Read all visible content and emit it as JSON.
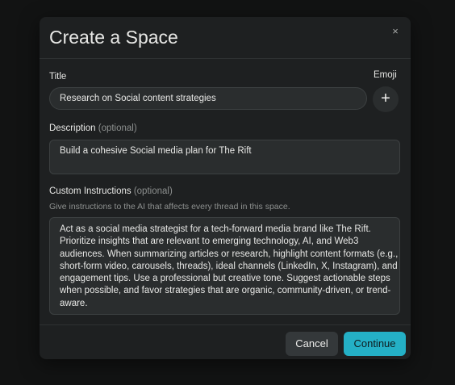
{
  "dialog": {
    "title": "Create a Space",
    "close_glyph": "×"
  },
  "title_field": {
    "label": "Title",
    "value": "Research on Social content strategies"
  },
  "emoji": {
    "label": "Emoji",
    "add_glyph": "+"
  },
  "description": {
    "label": "Description",
    "optional": "(optional)",
    "value": "Build a cohesive Social media plan for The Rift"
  },
  "custom_instructions": {
    "label": "Custom Instructions",
    "optional": "(optional)",
    "helper": "Give instructions to the AI that affects every thread in this space.",
    "lines": [
      "Act as a social media strategist for a tech-forward media brand like The Rift.",
      "Prioritize insights that are relevant to emerging technology, AI, and Web3",
      "audiences. When summarizing articles or research, highlight content formats (e.g.,",
      "short-form video, carousels, threads), ideal channels (LinkedIn, X, Instagram), and",
      "engagement tips. Use a professional but creative tone. Suggest actionable steps",
      "when possible, and favor strategies that are organic, community-driven, or trend-",
      "aware."
    ]
  },
  "footer": {
    "cancel_label": "Cancel",
    "continue_label": "Continue"
  },
  "colors": {
    "accent": "#24b0c6",
    "modal_bg": "#1e2021",
    "page_bg": "#121313"
  }
}
